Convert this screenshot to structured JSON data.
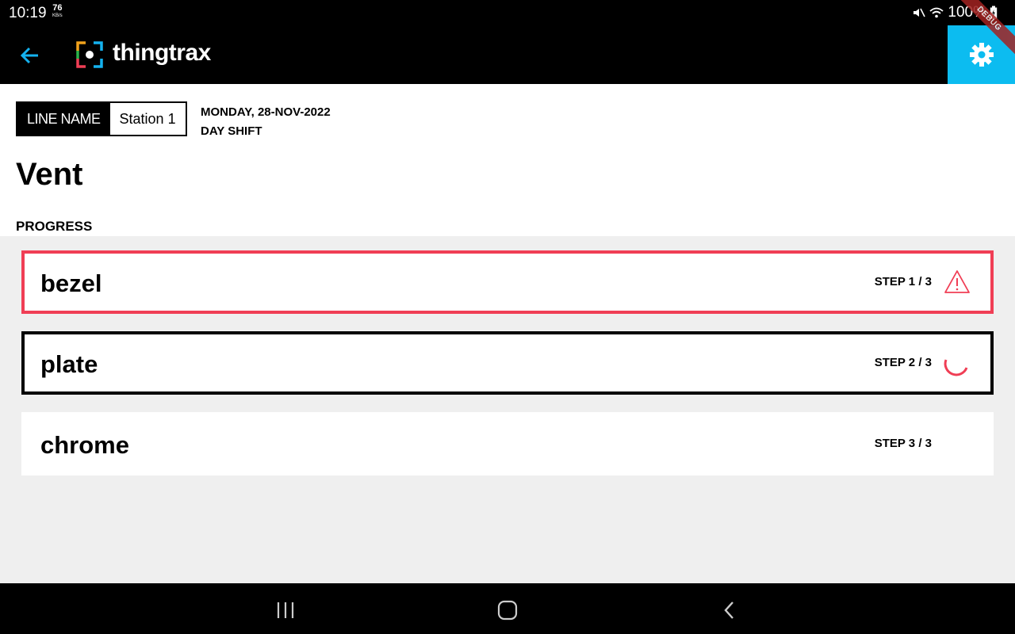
{
  "status_bar": {
    "time": "10:19",
    "net_rate_value": "76",
    "net_rate_unit": "KB/s",
    "battery_pct": "100%",
    "icons": [
      "mute-icon",
      "wifi-icon",
      "battery-icon"
    ]
  },
  "app_bar": {
    "brand": "thingtrax",
    "debug_banner": "DEBUG",
    "accent_color": "#0cbcf0"
  },
  "header": {
    "line_label": "LINE NAME",
    "line_value": "Station 1",
    "date": "MONDAY, 28-NOV-2022",
    "shift": "DAY SHIFT",
    "title": "Vent",
    "progress_label": "PROGRESS"
  },
  "steps": [
    {
      "name": "bezel",
      "step": "STEP 1 / 3",
      "status": "error",
      "icon": "warning-icon",
      "color": "#f03e55"
    },
    {
      "name": "plate",
      "step": "STEP 2 / 3",
      "status": "in-progress",
      "icon": "spinner-icon",
      "color": "#000000"
    },
    {
      "name": "chrome",
      "step": "STEP 3 / 3",
      "status": "pending",
      "icon": "",
      "color": "#ffffff"
    }
  ],
  "nav_bar": {
    "buttons": [
      "recent-apps-icon",
      "home-icon",
      "back-icon"
    ]
  }
}
